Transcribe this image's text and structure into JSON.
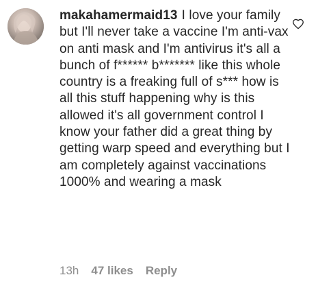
{
  "comment": {
    "username": "makahamermaid13",
    "text": "I love your family but I'll never take a vaccine I'm anti-vax on anti mask and I'm antivirus it's all a bunch of f****** b******* like this whole country is a freaking full of s*** how is all this stuff happening why is this allowed it's all government control I know your father did a great thing by getting warp speed and everything but I am completely against vaccinations 1000% and wearing a mask",
    "timestamp": "13h",
    "likes_label": "47 likes",
    "reply_label": "Reply",
    "avatar_icon": "user-avatar",
    "like_icon": "heart-outline-icon"
  }
}
